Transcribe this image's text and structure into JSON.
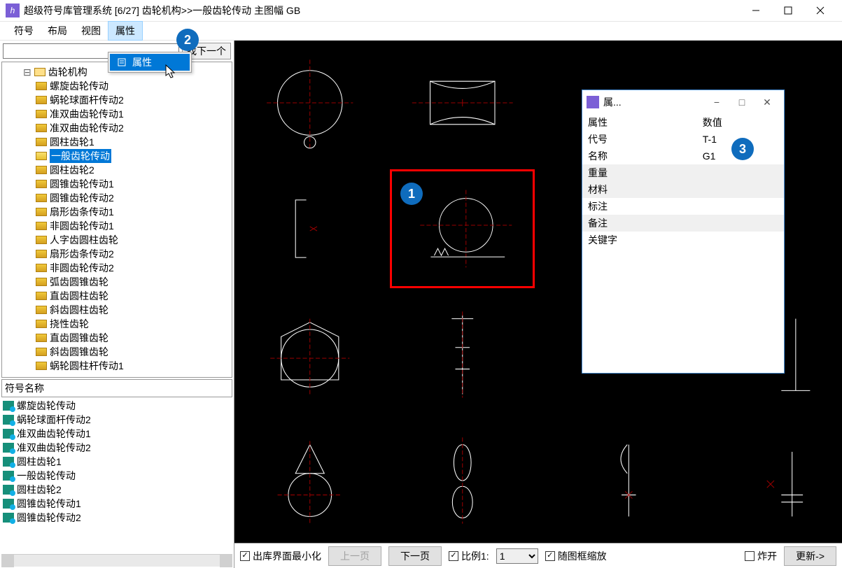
{
  "title": "超级符号库管理系统 [6/27] 齿轮机构>>一般齿轮传动 主图幅 GB",
  "menus": [
    "符号",
    "布局",
    "视图",
    "属性"
  ],
  "menu_active_index": 3,
  "dropdown": {
    "label": "属性"
  },
  "search": {
    "placeholder": "",
    "find_label": "找下一个"
  },
  "tree_root": "齿轮机构",
  "tree_items": [
    "螺旋齿轮传动",
    "蜗轮球面杆传动2",
    "准双曲齿轮传动1",
    "准双曲齿轮传动2",
    "圆柱齿轮1",
    "一般齿轮传动",
    "圆柱齿轮2",
    "圆锥齿轮传动1",
    "圆锥齿轮传动2",
    "扇形齿条传动1",
    "非圆齿轮传动1",
    "人字齿圆柱齿轮",
    "扇形齿条传动2",
    "非圆齿轮传动2",
    "弧齿圆锥齿轮",
    "直齿圆柱齿轮",
    "斜齿圆柱齿轮",
    "挠性齿轮",
    "直齿圆锥齿轮",
    "斜齿圆锥齿轮",
    "蜗轮圆柱杆传动1"
  ],
  "tree_selected_index": 5,
  "list_header": "符号名称",
  "list_items": [
    "螺旋齿轮传动",
    "蜗轮球面杆传动2",
    "准双曲齿轮传动1",
    "准双曲齿轮传动2",
    "圆柱齿轮1",
    "一般齿轮传动",
    "圆柱齿轮2",
    "圆锥齿轮传动1",
    "圆锥齿轮传动2"
  ],
  "prop_win": {
    "title": "属...",
    "cols": [
      "属性",
      "数值"
    ],
    "rows": [
      {
        "k": "代号",
        "v": "T-1"
      },
      {
        "k": "名称",
        "v": "G1"
      },
      {
        "k": "重量",
        "v": ""
      },
      {
        "k": "材料",
        "v": ""
      },
      {
        "k": "标注",
        "v": ""
      },
      {
        "k": "备注",
        "v": ""
      },
      {
        "k": "关键字",
        "v": ""
      }
    ]
  },
  "bottom": {
    "min_label": "出库界面最小化",
    "prev": "上一页",
    "next": "下一页",
    "ratio_label": "比例1:",
    "ratio_value": "1",
    "fit_label": "随图框缩放",
    "explode_label": "炸开",
    "refresh": "更新->"
  },
  "callouts": {
    "1": "1",
    "2": "2",
    "3": "3"
  }
}
